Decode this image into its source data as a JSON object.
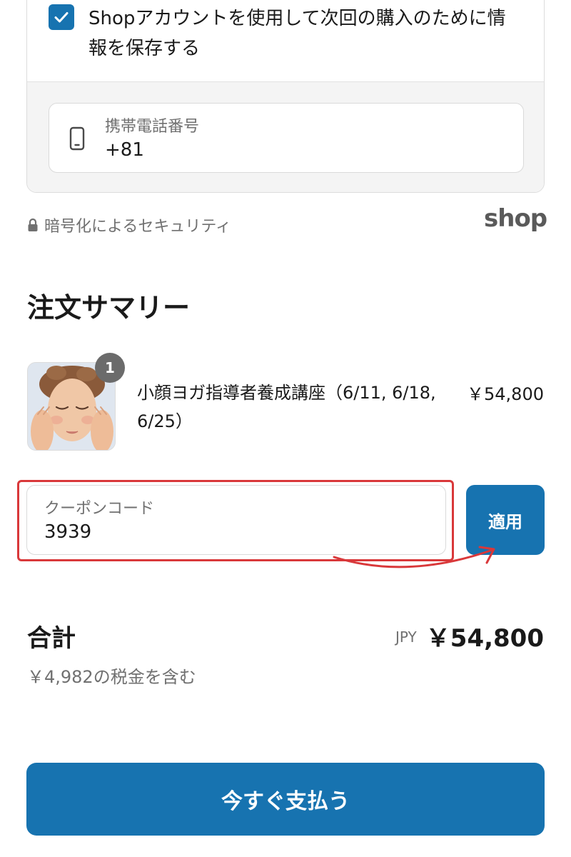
{
  "shop_save": {
    "checked": true,
    "label": "Shopアカウントを使用して次回の購入のために情報を保存する",
    "phone": {
      "label": "携帯電話番号",
      "value": "+81"
    }
  },
  "security": {
    "text": "暗号化によるセキュリティ",
    "shop_logo": "shop"
  },
  "summary": {
    "title": "注文サマリー",
    "product": {
      "quantity": "1",
      "name": "小顔ヨガ指導者養成講座（6/11, 6/18, 6/25）",
      "price": "￥54,800"
    }
  },
  "coupon": {
    "label": "クーポンコード",
    "value": "3939",
    "apply_label": "適用"
  },
  "total": {
    "label": "合計",
    "currency": "JPY",
    "amount": "￥54,800",
    "tax_note": "￥4,982の税金を含む"
  },
  "pay": {
    "label": "今すぐ支払う"
  },
  "colors": {
    "accent": "#1773b0",
    "highlight": "#d9383a",
    "muted_text": "#707070"
  }
}
